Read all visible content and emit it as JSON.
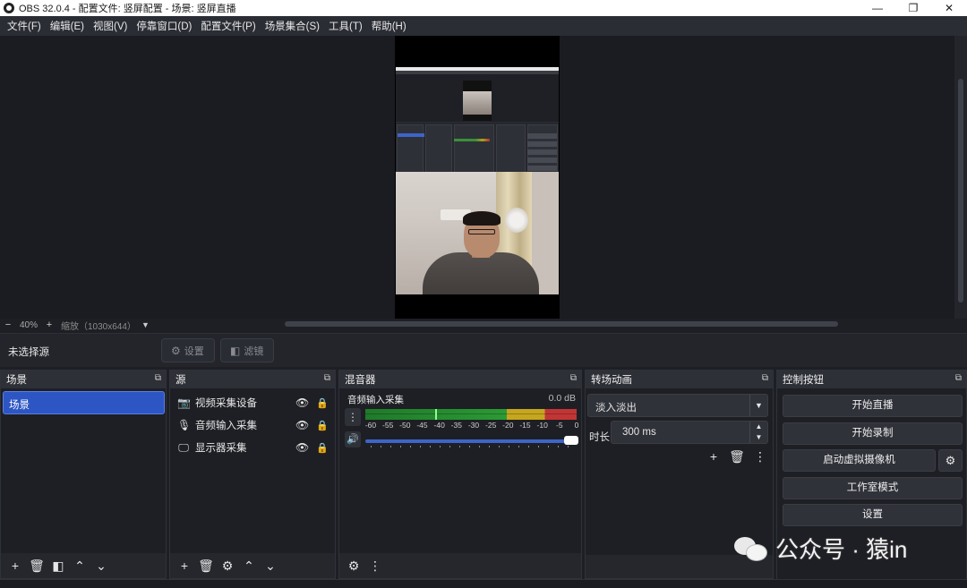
{
  "window": {
    "title": "OBS 32.0.4 - 配置文件: 竖屏配置 - 场景: 竖屏直播",
    "minimize": "—",
    "maximize": "❐",
    "close": "✕"
  },
  "menu": [
    "文件(F)",
    "编辑(E)",
    "视图(V)",
    "停靠窗口(D)",
    "配置文件(P)",
    "场景集合(S)",
    "工具(T)",
    "帮助(H)"
  ],
  "preview_bar": {
    "zoom_out": "−",
    "zoom": "40%",
    "zoom_in": "+",
    "scale_label": "缩放（1030x644）",
    "dropdown": "▼"
  },
  "source_toolbar": {
    "no_source": "未选择源",
    "settings": "设置",
    "filters": "滤镜"
  },
  "scenes": {
    "title": "场景",
    "items": [
      "场景"
    ]
  },
  "sources": {
    "title": "源",
    "items": [
      {
        "name": "视频采集设备",
        "icon": "camera-icon"
      },
      {
        "name": "音频输入采集",
        "icon": "microphone-icon"
      },
      {
        "name": "显示器采集",
        "icon": "monitor-icon"
      }
    ]
  },
  "mixer": {
    "title": "混音器",
    "channel_name": "音频输入采集",
    "db": "0.0 dB",
    "level": 0.33,
    "volume": 1.0,
    "ticks": [
      "-60",
      "-55",
      "-50",
      "-45",
      "-40",
      "-35",
      "-30",
      "-25",
      "-20",
      "-15",
      "-10",
      "-5",
      "0"
    ]
  },
  "transitions": {
    "title": "转场动画",
    "selected": "淡入淡出",
    "duration_label": "时长",
    "duration": "300 ms"
  },
  "controls": {
    "title": "控制按钮",
    "start_stream": "开始直播",
    "start_record": "开始录制",
    "virtual_camera": "启动虚拟摄像机",
    "studio_mode": "工作室模式",
    "settings": "设置"
  },
  "watermark": {
    "text": "公众号 · 猿in"
  }
}
